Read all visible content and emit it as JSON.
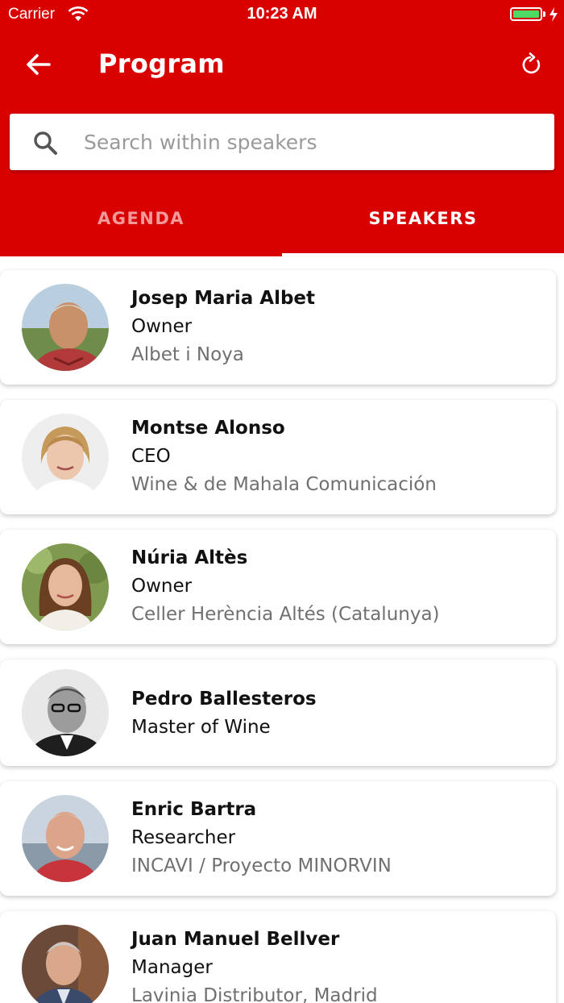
{
  "status_bar": {
    "carrier": "Carrier",
    "time": "10:23 AM",
    "battery_level": 1.0
  },
  "header": {
    "title": "Program",
    "back_icon": "arrow-left-icon",
    "refresh_icon": "refresh-icon"
  },
  "search": {
    "placeholder": "Search within speakers",
    "value": ""
  },
  "tabs": [
    {
      "label": "AGENDA",
      "active": false
    },
    {
      "label": "SPEAKERS",
      "active": true
    }
  ],
  "colors": {
    "brand_red": "#d90000",
    "inactive_tab": "#f29a9a",
    "battery_green": "#4cd964"
  },
  "speakers": [
    {
      "name": "Josep Maria Albet",
      "role": "Owner",
      "company": "Albet i Noya"
    },
    {
      "name": "Montse Alonso",
      "role": "CEO",
      "company": "Wine & de Mahala Comunicación"
    },
    {
      "name": "Núria Altès",
      "role": "Owner",
      "company": "Celler Herència Altés (Catalunya)"
    },
    {
      "name": "Pedro Ballesteros",
      "role": "Master of Wine",
      "company": ""
    },
    {
      "name": "Enric Bartra",
      "role": "Researcher",
      "company": "INCAVI / Proyecto MINORVIN"
    },
    {
      "name": "Juan Manuel Bellver",
      "role": "Manager",
      "company": "Lavinia Distributor, Madrid"
    }
  ]
}
